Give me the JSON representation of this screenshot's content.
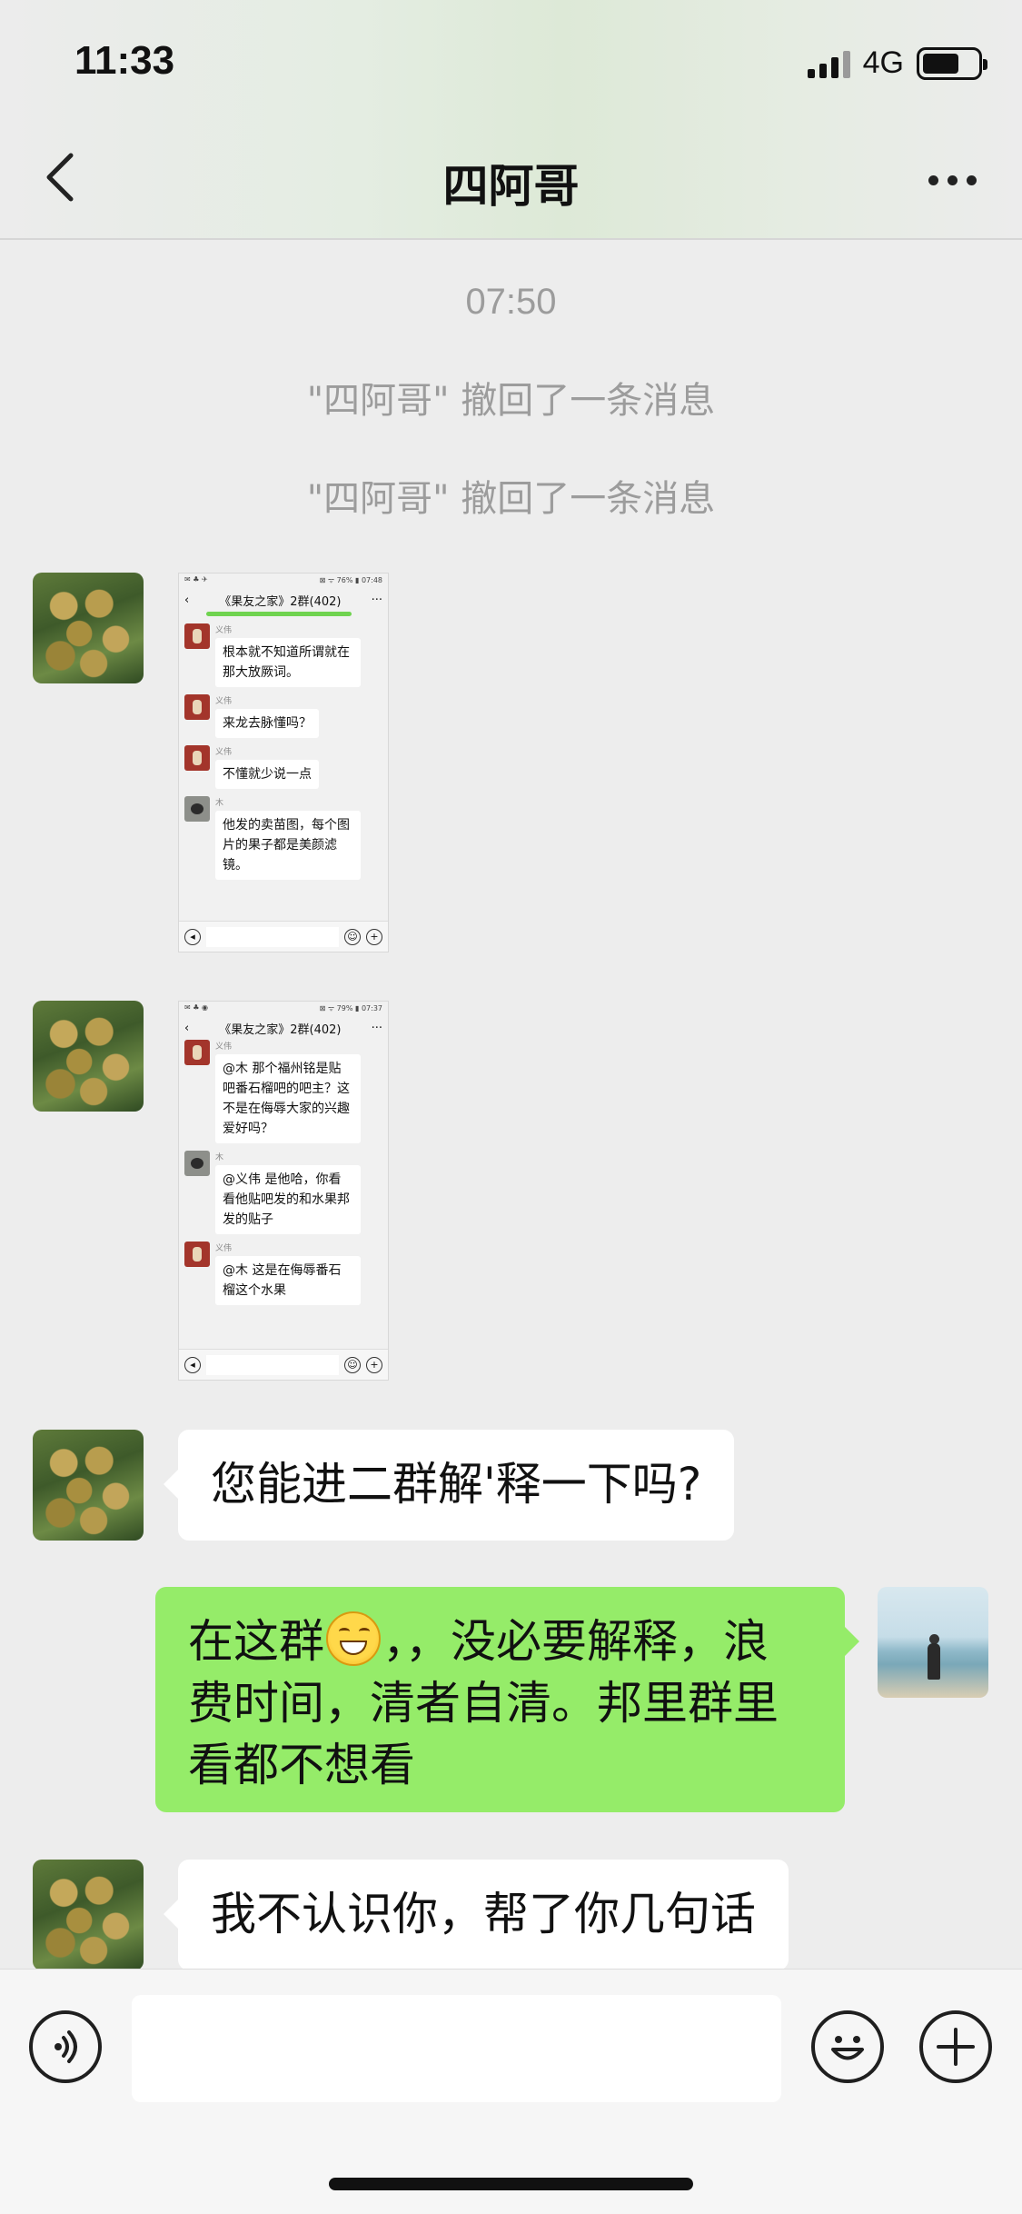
{
  "status_bar": {
    "time": "11:33",
    "network": "4G"
  },
  "nav": {
    "title": "四阿哥"
  },
  "chat": {
    "timestamp": "07:50",
    "recall_notices": [
      "\"四阿哥\" 撤回了一条消息",
      "\"四阿哥\" 撤回了一条消息"
    ],
    "image_1": {
      "status_left": "✉ ♣ ✈",
      "status_right": "⊠ ᯤ 76% ▮ 07:48",
      "title": "《果友之家》2群(402)",
      "messages": [
        {
          "name": "义伟",
          "text": "根本就不知道所谓就在那大放厥词。"
        },
        {
          "name": "义伟",
          "text": "来龙去脉懂吗？"
        },
        {
          "name": "义伟",
          "text": "不懂就少说一点"
        },
        {
          "name": "木",
          "text": "他发的卖苗图，每个图片的果子都是美颜滤镜。"
        }
      ]
    },
    "image_2": {
      "status_left": "✉ ♣ ◉",
      "status_right": "⊠ ᯤ 79% ▮ 07:37",
      "title": "《果友之家》2群(402)",
      "messages": [
        {
          "name": "义伟",
          "text": "@木  那个福州铭是贴吧番石榴吧的吧主？这不是在侮辱大家的兴趣爱好吗？"
        },
        {
          "name": "木",
          "text": "@义伟  是他哈，你看看他贴吧发的和水果邦发的贴子"
        },
        {
          "name": "义伟",
          "text": "@木  这是在侮辱番石榴这个水果"
        }
      ]
    },
    "msg_in_1": "您能进二群解'释一下吗?",
    "msg_out_1_before": "在这群",
    "msg_out_1_after": "，，没必要解释，浪费时间，清者自清。邦里群里看都不想看",
    "msg_in_2": "我不认识你，帮了你几句话"
  }
}
